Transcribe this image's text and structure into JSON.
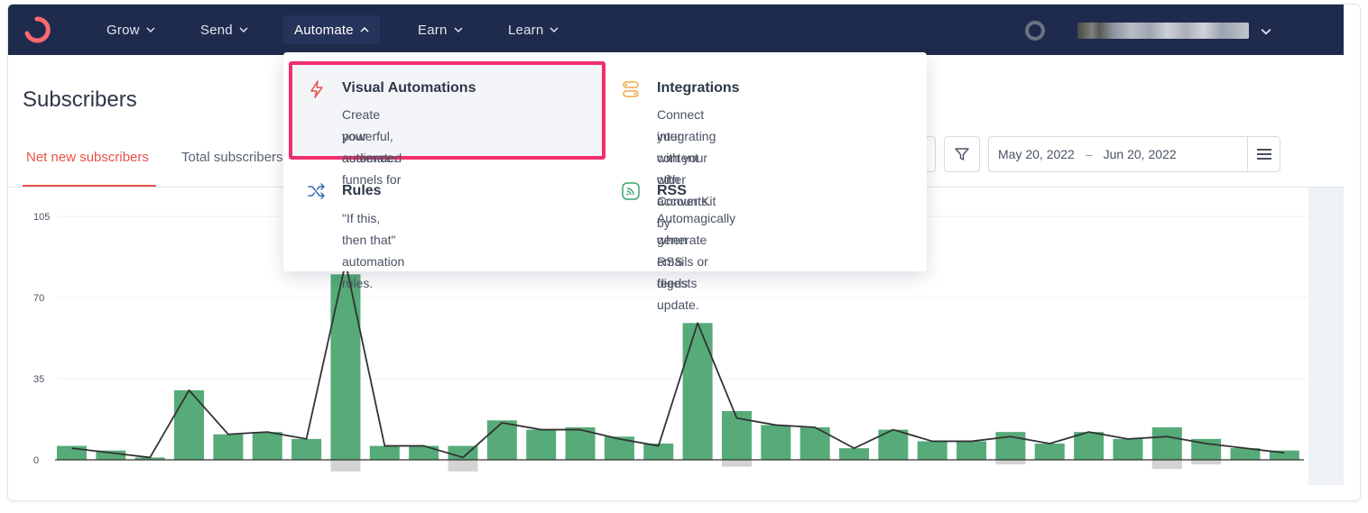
{
  "nav": {
    "items": [
      {
        "label": "Grow"
      },
      {
        "label": "Send"
      },
      {
        "label": "Automate"
      },
      {
        "label": "Earn"
      },
      {
        "label": "Learn"
      }
    ],
    "active": "Automate"
  },
  "page": {
    "title": "Subscribers",
    "tabs": [
      {
        "label": "Net new subscribers"
      },
      {
        "label": "Total subscribers"
      }
    ]
  },
  "date_range": {
    "start": "May 20, 2022",
    "separator": "–",
    "end": "Jun 20, 2022"
  },
  "dropdown": {
    "items": [
      {
        "icon": "lightning-icon",
        "title": "Visual Automations",
        "desc_line1": "Create powerful, automated funnels for",
        "desc_line2": "your audience."
      },
      {
        "icon": "integrations-icon",
        "title": "Integrations",
        "desc_line1": "Connect your content with ConvertKit by",
        "desc_line2": "integrating with your other accounts."
      },
      {
        "icon": "shuffle-icon",
        "title": "Rules",
        "desc_line1": "\"If this, then that\" automation rules.",
        "desc_line2": ""
      },
      {
        "icon": "rss-icon",
        "title": "RSS",
        "desc_line1": "Automagically generate emails or digests",
        "desc_line2": "when RSS feeds update."
      }
    ]
  },
  "colors": {
    "nav_bg": "#1f2b4d",
    "accent": "#e8534a",
    "highlight_border": "#ef2f6c",
    "bar": "#56ab78",
    "negative_bar": "#d3d3d3",
    "line": "#333333"
  },
  "chart_data": {
    "type": "bar",
    "y_ticks": [
      "105",
      "70",
      "35",
      "0"
    ],
    "ylim": [
      -5,
      105
    ],
    "series": [
      {
        "values": [
          6,
          4,
          1,
          30,
          11,
          12,
          9,
          80,
          6,
          6,
          6,
          17,
          13,
          14,
          10,
          7,
          59,
          21,
          15,
          14,
          5,
          13,
          8,
          8,
          12,
          7,
          12,
          9,
          14,
          9,
          5,
          4
        ]
      },
      {
        "values": [
          0,
          0,
          0,
          0,
          0,
          0,
          0,
          -5,
          0,
          0,
          -5,
          0,
          0,
          0,
          0,
          0,
          0,
          -3,
          0,
          0,
          0,
          0,
          0,
          0,
          -2,
          0,
          0,
          0,
          -4,
          -2,
          0,
          0
        ]
      },
      {
        "type": "line",
        "values": [
          5,
          3,
          1,
          30,
          11,
          12,
          9,
          85,
          6,
          6,
          1,
          16,
          13,
          13,
          9,
          6,
          59,
          18,
          15,
          14,
          5,
          13,
          8,
          8,
          10,
          7,
          12,
          9,
          10,
          7,
          5,
          3
        ]
      }
    ]
  }
}
